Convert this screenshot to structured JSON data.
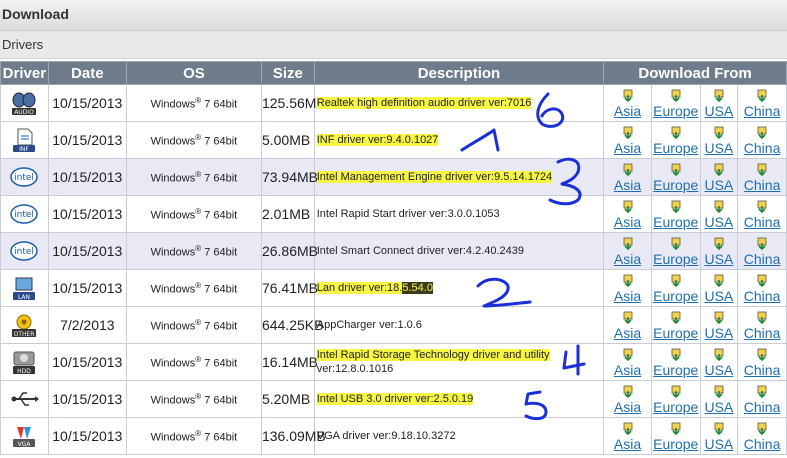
{
  "header": {
    "title": "Download"
  },
  "section": {
    "title": "Drivers"
  },
  "table": {
    "columns": [
      "Driver",
      "Date",
      "OS",
      "Size",
      "Description",
      "Download From"
    ],
    "os": {
      "prefix": "Windows",
      "sup": "®",
      "suffix": " 7 64bit"
    },
    "regions": [
      "Asia",
      "Europe",
      "USA",
      "China"
    ],
    "rows": [
      {
        "icon": "AUDIO",
        "date": "10/15/2013",
        "size": "125.56MB",
        "description": "Realtek high definition audio driver ver:7016"
      },
      {
        "icon": "INF",
        "date": "10/15/2013",
        "size": "5.00MB",
        "description": "INF driver ver:9.4.0.1027"
      },
      {
        "icon": "intel",
        "date": "10/15/2013",
        "size": "73.94MB",
        "description": "Intel Management Engine driver ver:9.5.14.1724"
      },
      {
        "icon": "intel",
        "date": "10/15/2013",
        "size": "2.01MB",
        "description": "Intel Rapid Start driver ver:3.0.0.1053"
      },
      {
        "icon": "intel",
        "date": "10/15/2013",
        "size": "26.86MB",
        "description": "Intel Smart Connect driver ver:4.2.40.2439"
      },
      {
        "icon": "LAN",
        "date": "10/15/2013",
        "size": "76.41MB",
        "description_a": "Lan driver ver:18.",
        "description_b": "5.54.0"
      },
      {
        "icon": "OTHER",
        "date": "7/2/2013",
        "size": "644.25KB",
        "description": "AppCharger ver:1.0.6"
      },
      {
        "icon": "HDD",
        "date": "10/15/2013",
        "size": "16.14MB",
        "description_a": "Intel Rapid Storage Technology driver and utility",
        "description_b": "ver:12.8.0.1016"
      },
      {
        "icon": "USB",
        "date": "10/15/2013",
        "size": "5.20MB",
        "description": "Intel USB 3.0 driver ver:2.5.0.19"
      },
      {
        "icon": "VGA",
        "date": "10/15/2013",
        "size": "136.09MB",
        "description": "VGA driver ver:9.18.10.3272"
      }
    ]
  },
  "annotations": {
    "numbers": [
      "6",
      "1",
      "3",
      "2",
      "4",
      "5"
    ]
  },
  "colors": {
    "highlight": "#f7f743",
    "link": "#1f6fb0",
    "header": "#6f7c8c",
    "annotation": "#1a2fd8"
  }
}
